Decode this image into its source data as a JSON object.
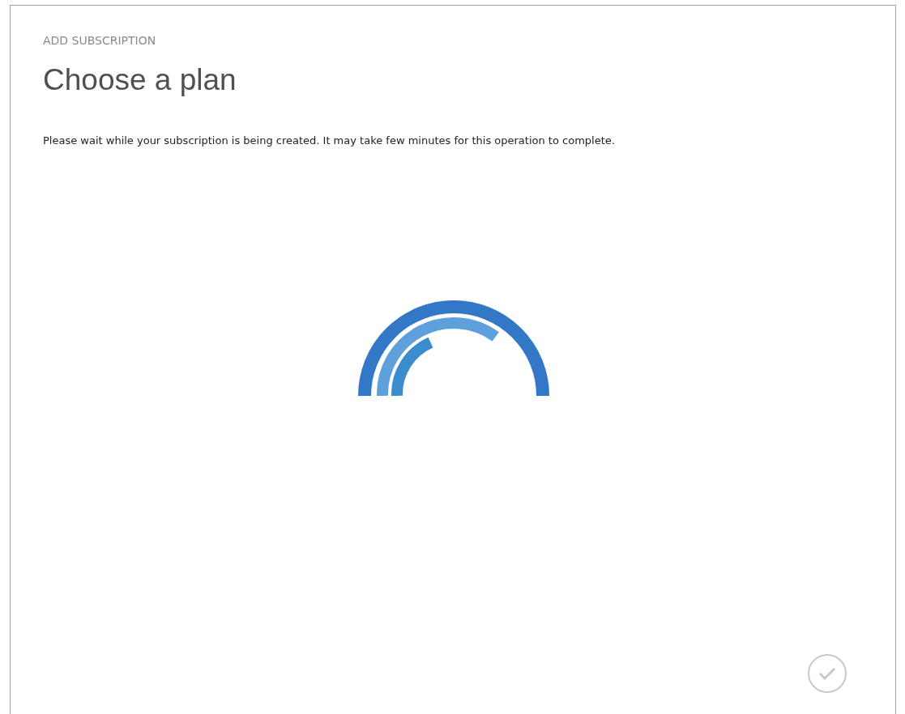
{
  "dialog": {
    "section_label": "ADD SUBSCRIPTION",
    "title": "Choose a plan",
    "message": "Please wait while your subscription is being created. It may take few minutes for this operation to complete.",
    "confirm_button": {
      "disabled": true
    }
  }
}
